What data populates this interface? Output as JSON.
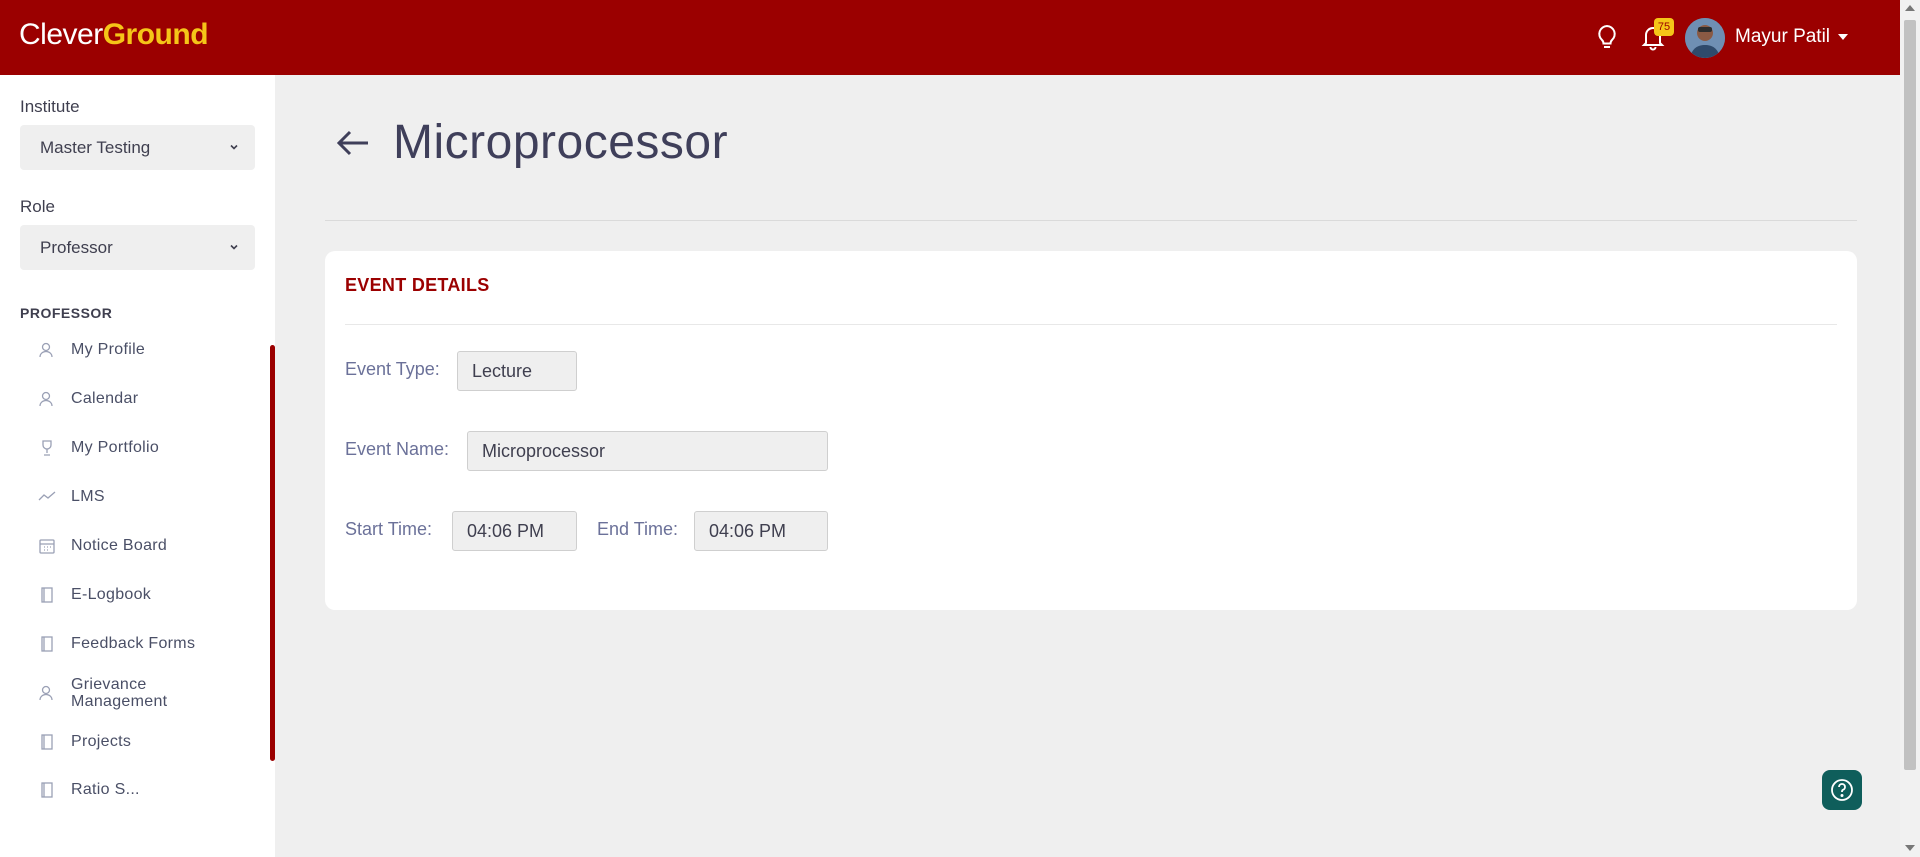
{
  "header": {
    "logo_part1": "Clever",
    "logo_part2": "Ground",
    "notification_count": "75",
    "user_name": "Mayur Patil",
    "brand_color": "#9b0000",
    "accent_color": "#f5c518"
  },
  "sidebar": {
    "institute_label": "Institute",
    "institute_value": "Master Testing",
    "role_label": "Role",
    "role_value": "Professor",
    "section_heading": "PROFESSOR",
    "items": [
      {
        "label": "My Profile",
        "icon": "user-icon"
      },
      {
        "label": "Calendar",
        "icon": "user-icon"
      },
      {
        "label": "My Portfolio",
        "icon": "trophy-icon"
      },
      {
        "label": "LMS",
        "icon": "trend-icon"
      },
      {
        "label": "Notice Board",
        "icon": "calendar-icon"
      },
      {
        "label": "E-Logbook",
        "icon": "book-icon"
      },
      {
        "label": "Feedback Forms",
        "icon": "book-icon"
      },
      {
        "label": "Grievance Management",
        "icon": "user-icon"
      },
      {
        "label": "Projects",
        "icon": "book-icon"
      },
      {
        "label": "Ratio S...",
        "icon": "book-icon"
      }
    ]
  },
  "main": {
    "title": "Microprocessor",
    "card": {
      "title": "EVENT DETAILS",
      "event_type_label": "Event Type",
      "event_type_value": "Lecture",
      "event_name_label": "Event Name",
      "event_name_value": "Microprocessor",
      "start_time_label": "Start Time",
      "start_time_value": "04:06 PM",
      "end_time_label": "End Time",
      "end_time_value": "04:06 PM",
      "colon": ":"
    }
  }
}
